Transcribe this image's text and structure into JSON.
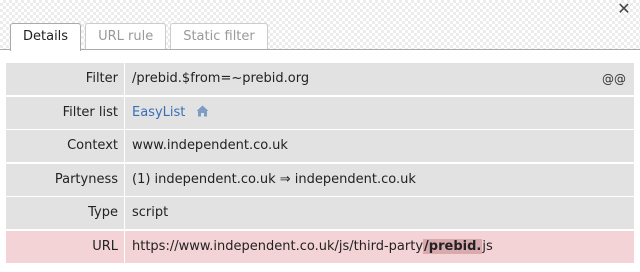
{
  "close_glyph": "✕",
  "tabs": [
    {
      "label": "Details",
      "active": true
    },
    {
      "label": "URL rule",
      "active": false
    },
    {
      "label": "Static filter",
      "active": false
    }
  ],
  "rows": {
    "filter": {
      "label": "Filter",
      "value": "/prebid.$from=~prebid.org",
      "action": "@@"
    },
    "filter_list": {
      "label": "Filter list",
      "value": "EasyList"
    },
    "context": {
      "label": "Context",
      "value": "www.independent.co.uk"
    },
    "partyness": {
      "label": "Partyness",
      "value": "(1)  independent.co.uk ⇒ independent.co.uk"
    },
    "type": {
      "label": "Type",
      "value": "script"
    },
    "url": {
      "label": "URL",
      "prefix": "https://www.independent.co.uk/js/third-party",
      "match": "/prebid.",
      "suffix": "js"
    }
  },
  "colors": {
    "row_bg": "#e2e2e2",
    "highlight_bg": "#f3d3d5",
    "match_bg": "#d8a9ad",
    "link": "#3a6fb5"
  },
  "icons": {
    "home": "home-icon",
    "close": "close-icon"
  }
}
